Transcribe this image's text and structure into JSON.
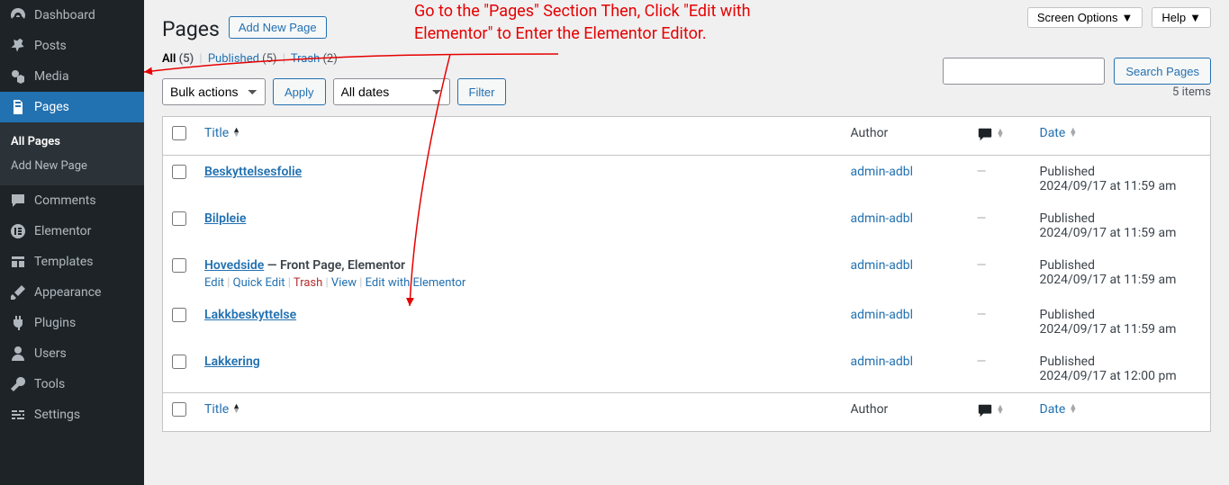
{
  "sidebar": {
    "items": [
      {
        "label": "Dashboard",
        "icon": "dashboard"
      },
      {
        "label": "Posts",
        "icon": "pin"
      },
      {
        "label": "Media",
        "icon": "media"
      },
      {
        "label": "Pages",
        "icon": "pages",
        "active": true
      },
      {
        "label": "Comments",
        "icon": "comment"
      },
      {
        "label": "Elementor",
        "icon": "elementor"
      },
      {
        "label": "Templates",
        "icon": "templates"
      },
      {
        "label": "Appearance",
        "icon": "brush"
      },
      {
        "label": "Plugins",
        "icon": "plug"
      },
      {
        "label": "Users",
        "icon": "user"
      },
      {
        "label": "Tools",
        "icon": "wrench"
      },
      {
        "label": "Settings",
        "icon": "sliders"
      }
    ],
    "sub": [
      {
        "label": "All Pages",
        "current": true
      },
      {
        "label": "Add New Page"
      }
    ]
  },
  "header": {
    "title": "Pages",
    "add_new": "Add New Page",
    "screen_options": "Screen Options",
    "help": "Help"
  },
  "filters": {
    "all_label": "All",
    "all_count": "(5)",
    "published_label": "Published",
    "published_count": "(5)",
    "trash_label": "Trash",
    "trash_count": "(2)"
  },
  "bulk": {
    "select": "Bulk actions",
    "apply": "Apply",
    "dates": "All dates",
    "filter": "Filter",
    "items_count": "5 items"
  },
  "search": {
    "button": "Search Pages",
    "placeholder": ""
  },
  "columns": {
    "title": "Title",
    "author": "Author",
    "date": "Date"
  },
  "rows": [
    {
      "title": "Beskyttelsesfolie",
      "author": "admin-adbl",
      "comments": "—",
      "date_status": "Published",
      "date": "2024/09/17 at 11:59 am"
    },
    {
      "title": "Bilpleie",
      "author": "admin-adbl",
      "comments": "—",
      "date_status": "Published",
      "date": "2024/09/17 at 11:59 am"
    },
    {
      "title": "Hovedside",
      "state": " — Front Page, Elementor",
      "author": "admin-adbl",
      "comments": "—",
      "date_status": "Published",
      "date": "2024/09/17 at 11:59 am",
      "hover": true,
      "actions": [
        {
          "t": "Edit",
          "c": "link"
        },
        {
          "t": "Quick Edit",
          "c": "link"
        },
        {
          "t": "Trash",
          "c": "trash"
        },
        {
          "t": "View",
          "c": "link"
        },
        {
          "t": "Edit with Elementor",
          "c": "link"
        }
      ]
    },
    {
      "title": "Lakkbeskyttelse",
      "author": "admin-adbl",
      "comments": "—",
      "date_status": "Published",
      "date": "2024/09/17 at 11:59 am"
    },
    {
      "title": "Lakkering",
      "author": "admin-adbl",
      "comments": "—",
      "date_status": "Published",
      "date": "2024/09/17 at 12:00 pm"
    }
  ],
  "annotation": {
    "text": "Go to the \"Pages\" Section Then, Click \"Edit with Elementor\" to Enter the Elementor Editor."
  }
}
